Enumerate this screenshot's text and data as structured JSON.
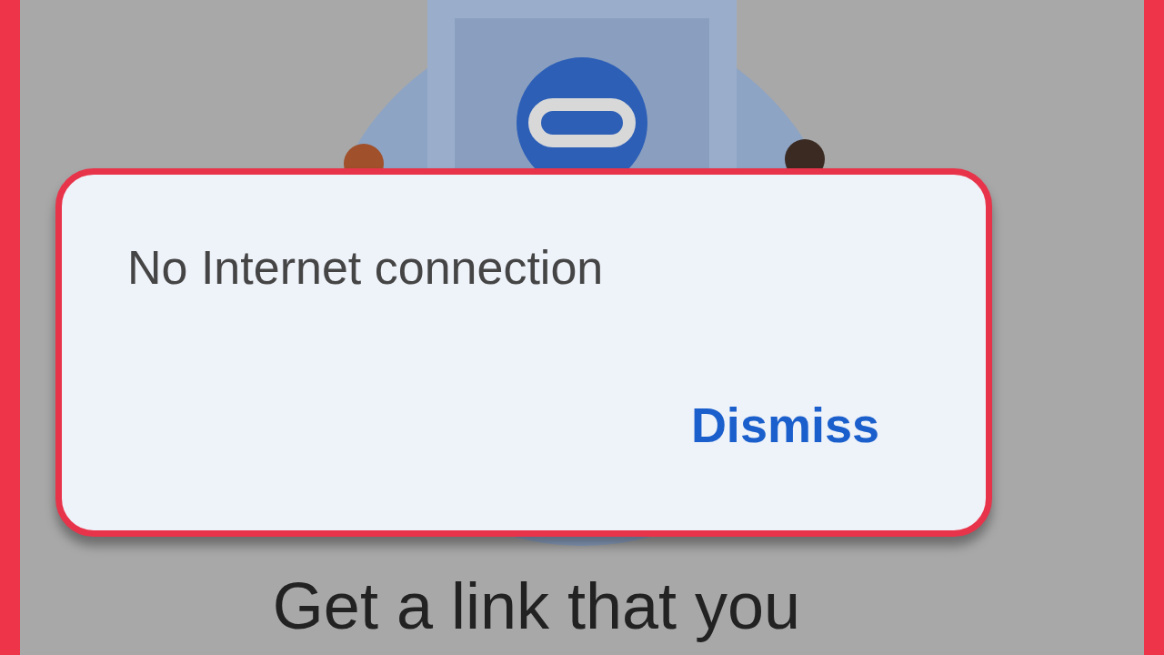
{
  "dialog": {
    "message": "No Internet connection",
    "action": "Dismiss"
  },
  "heading": "Get a link that you"
}
